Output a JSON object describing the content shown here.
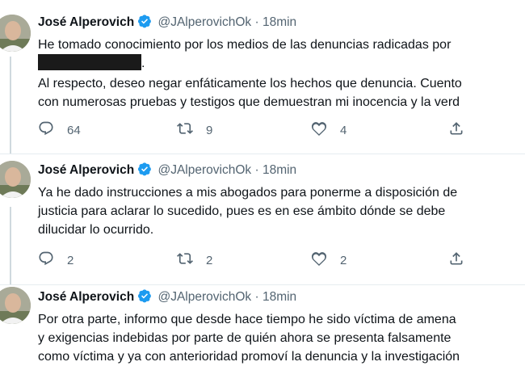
{
  "tweets": [
    {
      "name": "José Alperovich",
      "handle": "@JAlperovichOk",
      "separator": "·",
      "time": "18min",
      "lines": [
        "He tomado conocimiento por los medios de las denuncias radicadas por",
        ".",
        "Al respecto, deseo negar enfáticamente los hechos que denuncia. Cuento",
        "con numerosas pruebas y testigos que demuestran mi inocencia y  la verd"
      ],
      "replies": "64",
      "retweets": "9",
      "likes": "4"
    },
    {
      "name": "José Alperovich",
      "handle": "@JAlperovichOk",
      "separator": "·",
      "time": "18min",
      "lines": [
        "Ya he dado instrucciones a mis abogados para ponerme a disposición de",
        "justicia para aclarar lo sucedido, pues es en ese ámbito dónde se debe",
        "dilucidar lo ocurrido."
      ],
      "replies": "2",
      "retweets": "2",
      "likes": "2"
    },
    {
      "name": "José Alperovich",
      "handle": "@JAlperovichOk",
      "separator": "·",
      "time": "18min",
      "lines": [
        "Por otra parte, informo que desde hace tiempo he sido víctima de amena",
        "y exigencias indebidas por parte de quién ahora se presenta falsamente",
        "como víctima y ya con anterioridad promoví la denuncia y la investigación"
      ]
    }
  ],
  "icons": {
    "verified": "verified-badge-icon",
    "reply": "reply-icon",
    "retweet": "retweet-icon",
    "like": "heart-icon",
    "share": "share-icon"
  },
  "colors": {
    "verified": "#1d9bf0",
    "muted": "#536471",
    "text": "#0f1419",
    "thread_line": "#cfd9de"
  }
}
